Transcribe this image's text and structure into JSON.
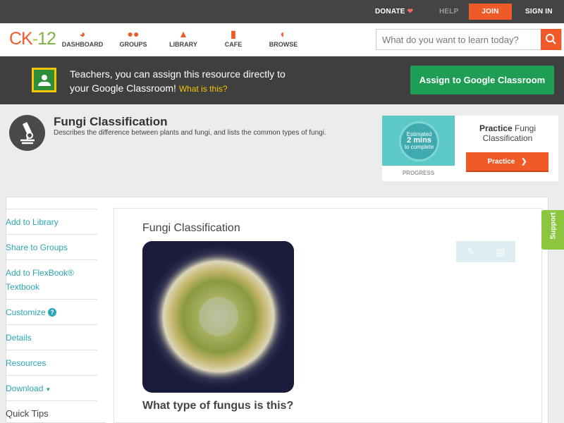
{
  "topbar": {
    "donate": "DONATE",
    "help": "HELP",
    "join": "JOIN",
    "signin": "SIGN IN"
  },
  "logo": {
    "ck": "CK",
    "dash": "-",
    "num": "12"
  },
  "nav": {
    "items": [
      {
        "label": "DASHBOARD",
        "icon": "dashboard-icon"
      },
      {
        "label": "GROUPS",
        "icon": "groups-icon"
      },
      {
        "label": "LIBRARY",
        "icon": "library-icon"
      },
      {
        "label": "CAFE",
        "icon": "cafe-icon"
      },
      {
        "label": "BROWSE",
        "icon": "browse-icon"
      }
    ]
  },
  "search": {
    "placeholder": "What do you want to learn today?"
  },
  "classroom": {
    "line1": "Teachers, you can assign this resource directly to",
    "line2": "your Google Classroom!",
    "what": "What is this?",
    "button": "Assign to Google Classroom"
  },
  "concept": {
    "title": "Fungi Classification",
    "description": "Describes the difference between plants and fungi, and lists the common types of fungi."
  },
  "practice": {
    "estimated": "Estimated",
    "mins": "2 mins",
    "to_complete": "to complete",
    "progress_label": "PROGRESS",
    "title_bold": "Practice",
    "title_rest": "Fungi Classification",
    "button": "Practice"
  },
  "sidebar": {
    "items": [
      {
        "label": "Add to Library"
      },
      {
        "label": "Share to Groups"
      },
      {
        "label": "Add to FlexBook® Textbook"
      },
      {
        "label": "Customize"
      },
      {
        "label": "Details"
      },
      {
        "label": "Resources"
      },
      {
        "label": "Download"
      },
      {
        "label": "Quick Tips"
      }
    ]
  },
  "main": {
    "title": "Fungi Classification",
    "question": "What type of fungus is this?"
  },
  "support": "Support",
  "colors": {
    "accent": "#f05a28",
    "link": "#2ba5b5",
    "classroom_green": "#1e9e54",
    "support_green": "#8cc63f"
  }
}
